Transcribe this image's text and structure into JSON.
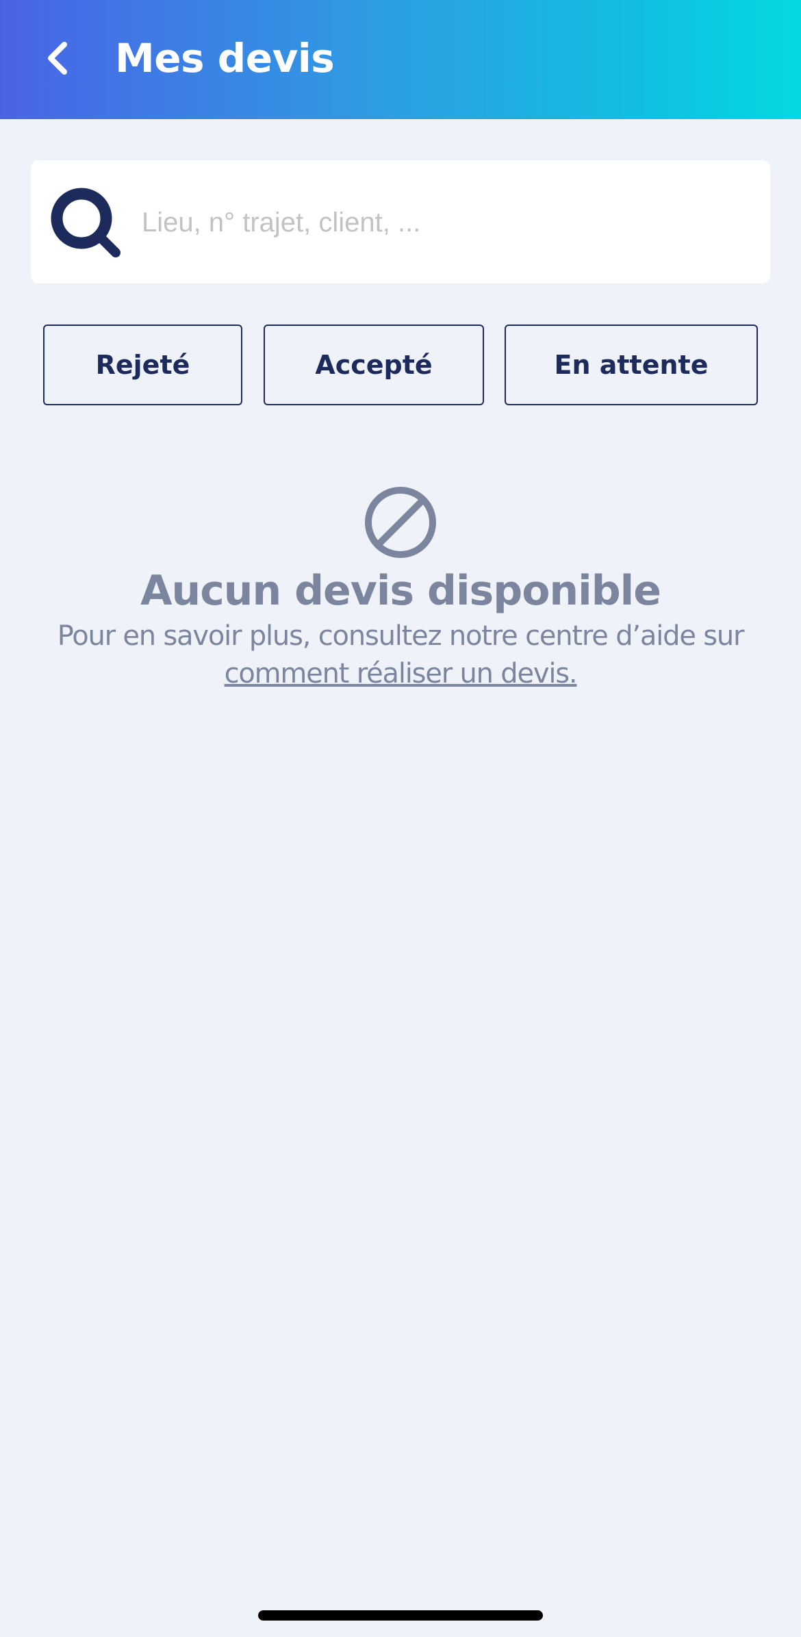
{
  "header": {
    "title": "Mes devis",
    "back_icon": "chevron-left-icon",
    "gradient_start": "#4a63e6",
    "gradient_end": "#04d8e0"
  },
  "search": {
    "placeholder": "Lieu, n° trajet, client, ...",
    "value": "",
    "icon": "search-icon",
    "icon_color": "#1d2a5c"
  },
  "filters": [
    {
      "label": "Rejeté"
    },
    {
      "label": "Accepté"
    },
    {
      "label": "En attente"
    }
  ],
  "empty_state": {
    "icon": "prohibited-icon",
    "title": "Aucun devis disponible",
    "text": "Pour en savoir plus, consultez notre centre d’aide sur",
    "link": "comment réaliser un devis.",
    "color": "#7b859e"
  },
  "colors": {
    "background": "#f0f2f9",
    "primary": "#1d2a5c"
  }
}
